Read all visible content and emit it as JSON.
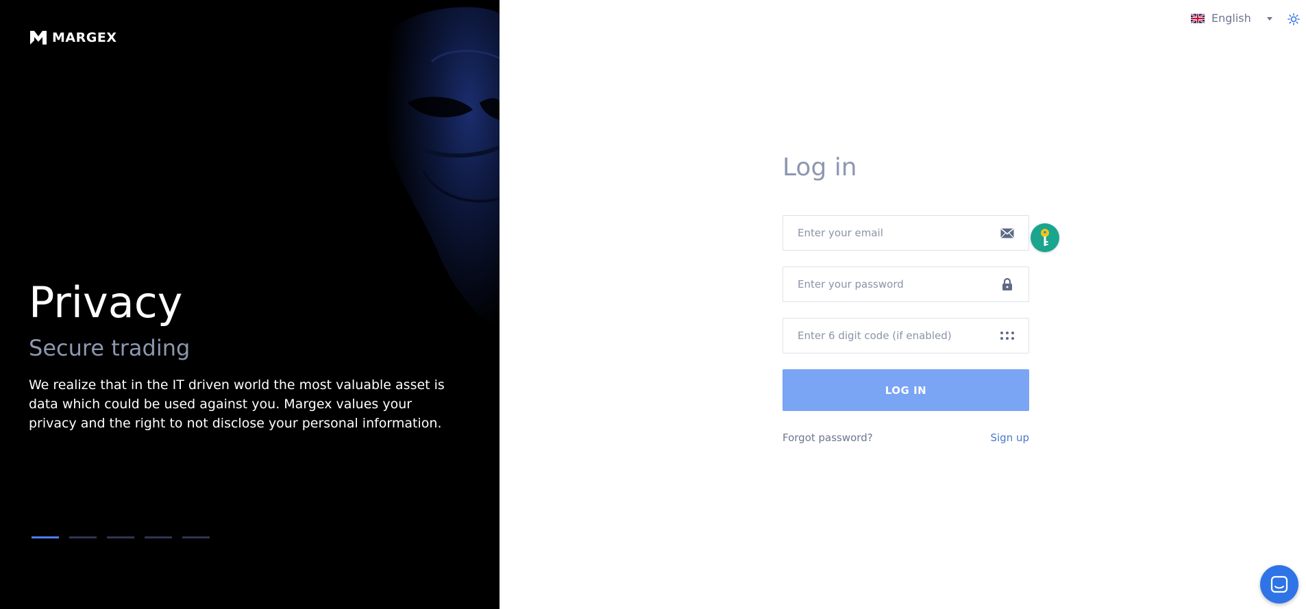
{
  "brand": {
    "name": "MARGEX"
  },
  "hero": {
    "title": "Privacy",
    "subtitle": "Secure trading",
    "description": "We realize that in the IT driven world the most valuable asset is data which could be used against you. Margex values your privacy and the right to not disclose your personal information.",
    "slides": [
      {
        "active": true
      },
      {
        "active": false
      },
      {
        "active": false
      },
      {
        "active": false
      },
      {
        "active": false
      }
    ]
  },
  "header": {
    "language": "English",
    "theme_icon": "sun-icon"
  },
  "login": {
    "title": "Log in",
    "email_placeholder": "Enter your email",
    "password_placeholder": "Enter your password",
    "code_placeholder": "Enter 6 digit code (if enabled)",
    "submit_label": "LOG IN",
    "forgot_label": "Forgot password?",
    "signup_label": "Sign up"
  },
  "colors": {
    "hero_bg": "#000000",
    "accent": "#4f7df5",
    "button": "#7aa4f4",
    "key_badge": "#1aa58e",
    "chat": "#2f74e6"
  },
  "icons": {
    "email": "envelope-icon",
    "password": "lock-icon",
    "code": "dots-grid-icon",
    "password_manager": "key-icon",
    "chat": "chat-icon",
    "language": "uk-flag-icon"
  }
}
